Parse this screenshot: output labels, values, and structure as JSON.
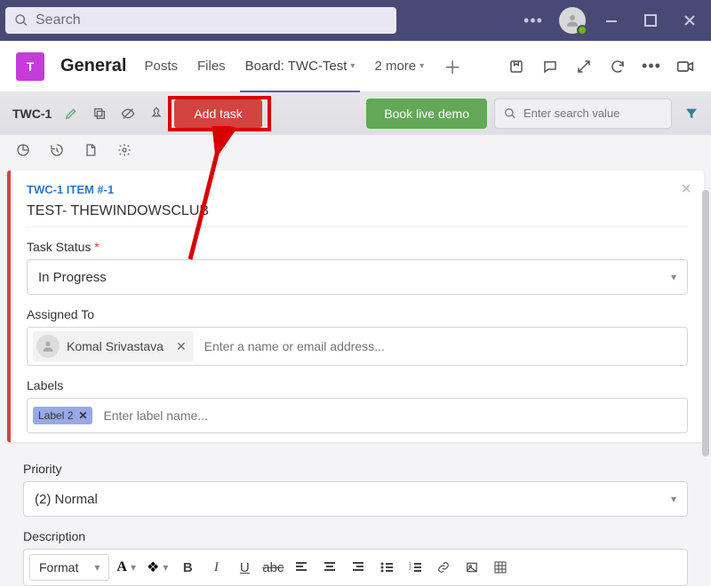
{
  "titlebar": {
    "search_placeholder": "Search"
  },
  "channel": {
    "icon_letter": "T",
    "title": "General",
    "tabs": {
      "posts": "Posts",
      "files": "Files",
      "board": "Board: TWC-Test",
      "more": "2 more"
    }
  },
  "toolbar": {
    "board_id": "TWC-1",
    "add_task": "Add task",
    "book_demo": "Book live demo",
    "search_placeholder": "Enter search value"
  },
  "task": {
    "item_id": "TWC-1 ITEM #-1",
    "title": "TEST- THEWINDOWSCLUB",
    "status_label": "Task Status",
    "status_value": "In Progress",
    "assigned_label": "Assigned To",
    "assigned_user": "Komal Srivastava",
    "assigned_placeholder": "Enter a name or email address...",
    "labels_label": "Labels",
    "label_chip": "Label 2",
    "labels_placeholder": "Enter label name...",
    "priority_label": "Priority",
    "priority_value": "(2) Normal",
    "description_label": "Description",
    "format_value": "Format"
  }
}
